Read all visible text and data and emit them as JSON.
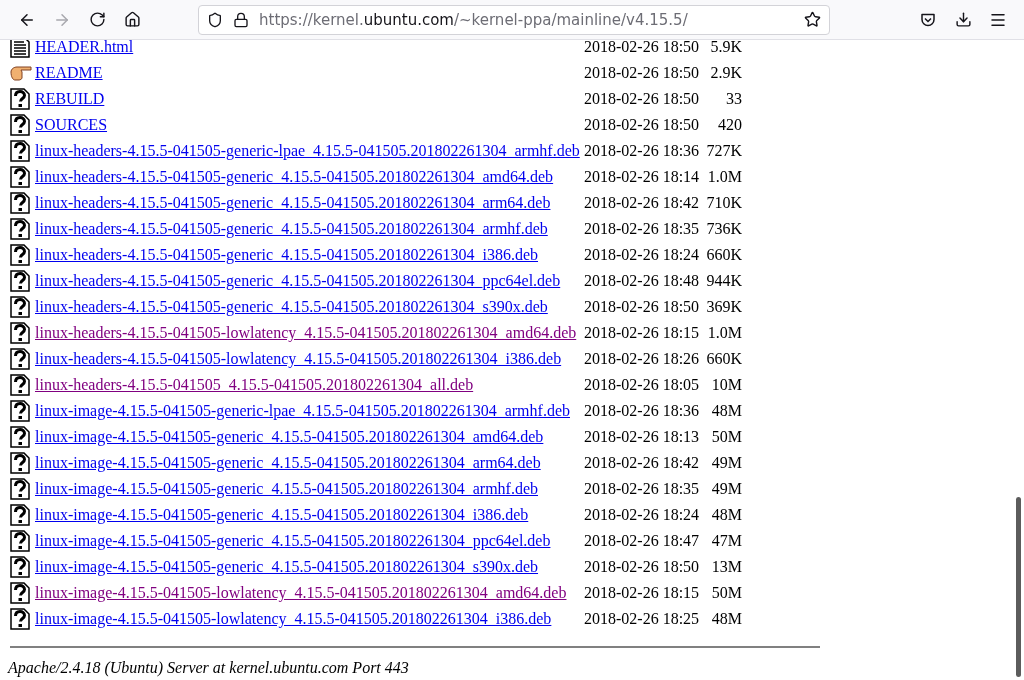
{
  "toolbar": {
    "url": {
      "scheme_host": "https://kernel.",
      "domain": "ubuntu.com",
      "path": "/~kernel-ppa/mainline/v4.15.5/"
    },
    "forward_disabled": true
  },
  "listing": [
    {
      "kind": "text",
      "name": "HEADER.html",
      "date": "2018-02-26 18:50",
      "size": "5.9K",
      "visited": false
    },
    {
      "kind": "hand",
      "name": "README",
      "date": "2018-02-26 18:50",
      "size": "2.9K",
      "visited": false
    },
    {
      "kind": "unknown",
      "name": "REBUILD",
      "date": "2018-02-26 18:50",
      "size": "33",
      "visited": false
    },
    {
      "kind": "unknown",
      "name": "SOURCES",
      "date": "2018-02-26 18:50",
      "size": "420",
      "visited": false
    },
    {
      "kind": "unknown",
      "name": "linux-headers-4.15.5-041505-generic-lpae_4.15.5-041505.201802261304_armhf.deb",
      "date": "2018-02-26 18:36",
      "size": "727K",
      "visited": false
    },
    {
      "kind": "unknown",
      "name": "linux-headers-4.15.5-041505-generic_4.15.5-041505.201802261304_amd64.deb",
      "date": "2018-02-26 18:14",
      "size": "1.0M",
      "visited": false
    },
    {
      "kind": "unknown",
      "name": "linux-headers-4.15.5-041505-generic_4.15.5-041505.201802261304_arm64.deb",
      "date": "2018-02-26 18:42",
      "size": "710K",
      "visited": false
    },
    {
      "kind": "unknown",
      "name": "linux-headers-4.15.5-041505-generic_4.15.5-041505.201802261304_armhf.deb",
      "date": "2018-02-26 18:35",
      "size": "736K",
      "visited": false
    },
    {
      "kind": "unknown",
      "name": "linux-headers-4.15.5-041505-generic_4.15.5-041505.201802261304_i386.deb",
      "date": "2018-02-26 18:24",
      "size": "660K",
      "visited": false
    },
    {
      "kind": "unknown",
      "name": "linux-headers-4.15.5-041505-generic_4.15.5-041505.201802261304_ppc64el.deb",
      "date": "2018-02-26 18:48",
      "size": "944K",
      "visited": false
    },
    {
      "kind": "unknown",
      "name": "linux-headers-4.15.5-041505-generic_4.15.5-041505.201802261304_s390x.deb",
      "date": "2018-02-26 18:50",
      "size": "369K",
      "visited": false
    },
    {
      "kind": "unknown",
      "name": "linux-headers-4.15.5-041505-lowlatency_4.15.5-041505.201802261304_amd64.deb",
      "date": "2018-02-26 18:15",
      "size": "1.0M",
      "visited": true
    },
    {
      "kind": "unknown",
      "name": "linux-headers-4.15.5-041505-lowlatency_4.15.5-041505.201802261304_i386.deb",
      "date": "2018-02-26 18:26",
      "size": "660K",
      "visited": false
    },
    {
      "kind": "unknown",
      "name": "linux-headers-4.15.5-041505_4.15.5-041505.201802261304_all.deb",
      "date": "2018-02-26 18:05",
      "size": "10M",
      "visited": true
    },
    {
      "kind": "unknown",
      "name": "linux-image-4.15.5-041505-generic-lpae_4.15.5-041505.201802261304_armhf.deb",
      "date": "2018-02-26 18:36",
      "size": "48M",
      "visited": false
    },
    {
      "kind": "unknown",
      "name": "linux-image-4.15.5-041505-generic_4.15.5-041505.201802261304_amd64.deb",
      "date": "2018-02-26 18:13",
      "size": "50M",
      "visited": false
    },
    {
      "kind": "unknown",
      "name": "linux-image-4.15.5-041505-generic_4.15.5-041505.201802261304_arm64.deb",
      "date": "2018-02-26 18:42",
      "size": "49M",
      "visited": false
    },
    {
      "kind": "unknown",
      "name": "linux-image-4.15.5-041505-generic_4.15.5-041505.201802261304_armhf.deb",
      "date": "2018-02-26 18:35",
      "size": "49M",
      "visited": false
    },
    {
      "kind": "unknown",
      "name": "linux-image-4.15.5-041505-generic_4.15.5-041505.201802261304_i386.deb",
      "date": "2018-02-26 18:24",
      "size": "48M",
      "visited": false
    },
    {
      "kind": "unknown",
      "name": "linux-image-4.15.5-041505-generic_4.15.5-041505.201802261304_ppc64el.deb",
      "date": "2018-02-26 18:47",
      "size": "47M",
      "visited": false
    },
    {
      "kind": "unknown",
      "name": "linux-image-4.15.5-041505-generic_4.15.5-041505.201802261304_s390x.deb",
      "date": "2018-02-26 18:50",
      "size": "13M",
      "visited": false
    },
    {
      "kind": "unknown",
      "name": "linux-image-4.15.5-041505-lowlatency_4.15.5-041505.201802261304_amd64.deb",
      "date": "2018-02-26 18:15",
      "size": "50M",
      "visited": true
    },
    {
      "kind": "unknown",
      "name": "linux-image-4.15.5-041505-lowlatency_4.15.5-041505.201802261304_i386.deb",
      "date": "2018-02-26 18:25",
      "size": "48M",
      "visited": false
    }
  ],
  "footer": "Apache/2.4.18 (Ubuntu) Server at kernel.ubuntu.com Port 443"
}
